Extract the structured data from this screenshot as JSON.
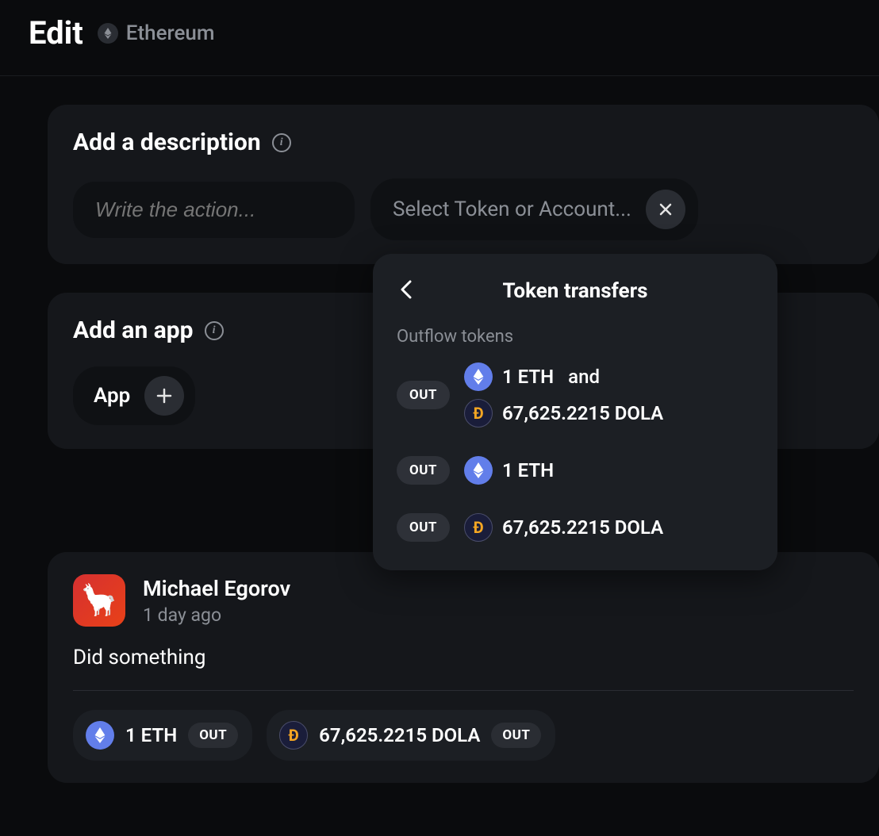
{
  "header": {
    "title": "Edit",
    "chain": "Ethereum"
  },
  "description": {
    "title": "Add a description",
    "action_placeholder": "Write the action...",
    "select_placeholder": "Select Token or Account..."
  },
  "app": {
    "title": "Add an app",
    "button_label": "App"
  },
  "popover": {
    "title": "Token transfers",
    "section_label": "Outflow tokens",
    "out_badge": "OUT",
    "and_text": "and",
    "transfers": [
      {
        "combined": true,
        "tokens": [
          {
            "type": "eth",
            "amount": "1 ETH"
          },
          {
            "type": "dola",
            "amount": "67,625.2215 DOLA"
          }
        ]
      },
      {
        "combined": false,
        "tokens": [
          {
            "type": "eth",
            "amount": "1 ETH"
          }
        ]
      },
      {
        "combined": false,
        "tokens": [
          {
            "type": "dola",
            "amount": "67,625.2215 DOLA"
          }
        ]
      }
    ]
  },
  "activity": {
    "author": "Michael Egorov",
    "time": "1 day ago",
    "description": "Did something",
    "out_badge": "OUT",
    "chips": [
      {
        "type": "eth",
        "amount": "1 ETH"
      },
      {
        "type": "dola",
        "amount": "67,625.2215 DOLA"
      }
    ]
  }
}
